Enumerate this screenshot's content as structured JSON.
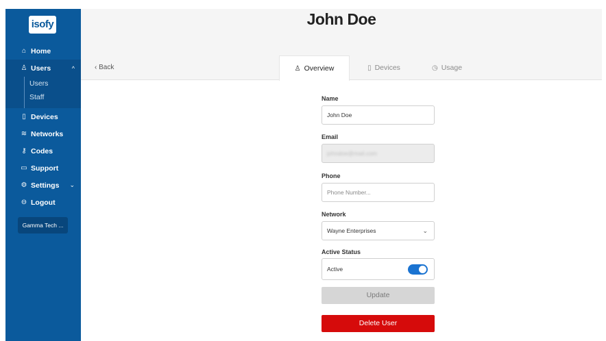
{
  "brand": {
    "logo_text": "isofy"
  },
  "sidebar": {
    "items": [
      {
        "label": "Home",
        "icon": "home-icon",
        "glyph": "⌂"
      },
      {
        "label": "Users",
        "icon": "user-icon",
        "glyph": "♙",
        "active": true,
        "expanded": true
      },
      {
        "label": "Devices",
        "icon": "device-icon",
        "glyph": "▯"
      },
      {
        "label": "Networks",
        "icon": "wifi-icon",
        "glyph": "≋"
      },
      {
        "label": "Codes",
        "icon": "key-icon",
        "glyph": "⚷"
      },
      {
        "label": "Support",
        "icon": "ticket-icon",
        "glyph": "▭"
      },
      {
        "label": "Settings",
        "icon": "gear-icon",
        "glyph": "⚙"
      },
      {
        "label": "Logout",
        "icon": "logout-icon",
        "glyph": "⊖"
      }
    ],
    "users_sub": [
      "Users",
      "Staff"
    ],
    "org_badge": "Gamma Tech ...",
    "chevron_up": "^",
    "chevron_down": "⌄"
  },
  "header": {
    "title": "John Doe",
    "back_label": "Back",
    "back_glyph": "‹",
    "tabs": [
      {
        "label": "Overview",
        "icon": "user-icon",
        "glyph": "♙",
        "active": true
      },
      {
        "label": "Devices",
        "icon": "device-icon",
        "glyph": "▯"
      },
      {
        "label": "Usage",
        "icon": "clock-icon",
        "glyph": "◷"
      }
    ]
  },
  "form": {
    "name_label": "Name",
    "name_value": "John Doe",
    "email_label": "Email",
    "email_value": "johndoe@mail.com",
    "phone_label": "Phone",
    "phone_placeholder": "Phone Number...",
    "network_label": "Network",
    "network_value": "Wayne Enterprises",
    "network_chevron": "⌄",
    "status_label": "Active Status",
    "status_value": "Active",
    "status_on": true,
    "update_label": "Update",
    "delete_label": "Delete User"
  },
  "colors": {
    "sidebar_bg": "#0b5a9c",
    "toggle_on": "#1a73d1",
    "delete_bg": "#d60b0b"
  }
}
